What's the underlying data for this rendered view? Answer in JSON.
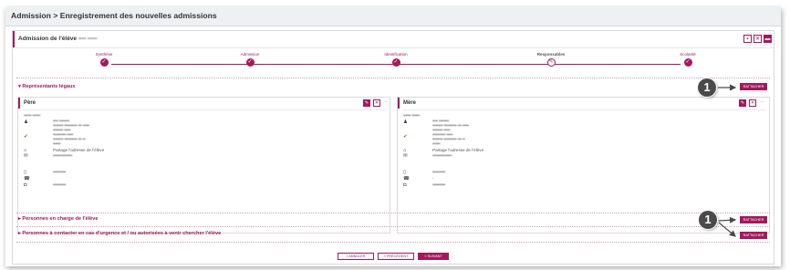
{
  "breadcrumb": "Admission > Enregistrement des nouvelles admissions",
  "panel": {
    "title": "Admission de l'élève",
    "blurred_name": "•••• •••••"
  },
  "steps": [
    {
      "label": "Synthèse",
      "mark": "✓"
    },
    {
      "label": "Admission",
      "mark": "✓"
    },
    {
      "label": "Identification",
      "mark": "✓"
    },
    {
      "label": "Responsables",
      "mark": "✎"
    },
    {
      "label": "Scolarité",
      "mark": "✓"
    }
  ],
  "sections": {
    "legal": "Représentants légaux",
    "in_charge": "Personnes en charge de l'élève",
    "emergency": "Personnes à contacter en cas d'urgence et / ou autorisées à venir chercher l'élève"
  },
  "attach_label": "RATTACHER",
  "callout_number": "1",
  "cards": [
    {
      "title": "Père",
      "name": "•••••• ••••••",
      "lines": [
        "•••• ••••••••",
        "•••••••• •••••••••• ••• •••••",
        "•••••••• •••••",
        "•••••••••• •••••",
        "•••••••• •••••••••• ••• ••",
        "••••••"
      ],
      "address_note": "Partage l'adresse de l'élève",
      "email": "•••••••••••••••",
      "phone": "••••••••••",
      "phone2": "",
      "other": "••••••••••"
    },
    {
      "title": "Mère",
      "name": "•••••• ••••••",
      "lines": [
        "•••• ••••••••",
        "•••••••• •••••••••• ••• •••••",
        "•••••••• •••••",
        "•••••••••• •••••",
        "•••••••• •••••••••• ••• ••",
        "••••••"
      ],
      "address_note": "Partage l'adresse de l'élève",
      "email": "•••••••••••••••",
      "phone": "••••••••••",
      "phone2": "-",
      "other": "••••••••••"
    }
  ],
  "footer": {
    "cancel": "« ANNULER",
    "previous": "« PRÉCÉDENT",
    "next": "» SUIVANT"
  },
  "colors": {
    "accent": "#a3195b",
    "callout": "#4a4a4a"
  }
}
